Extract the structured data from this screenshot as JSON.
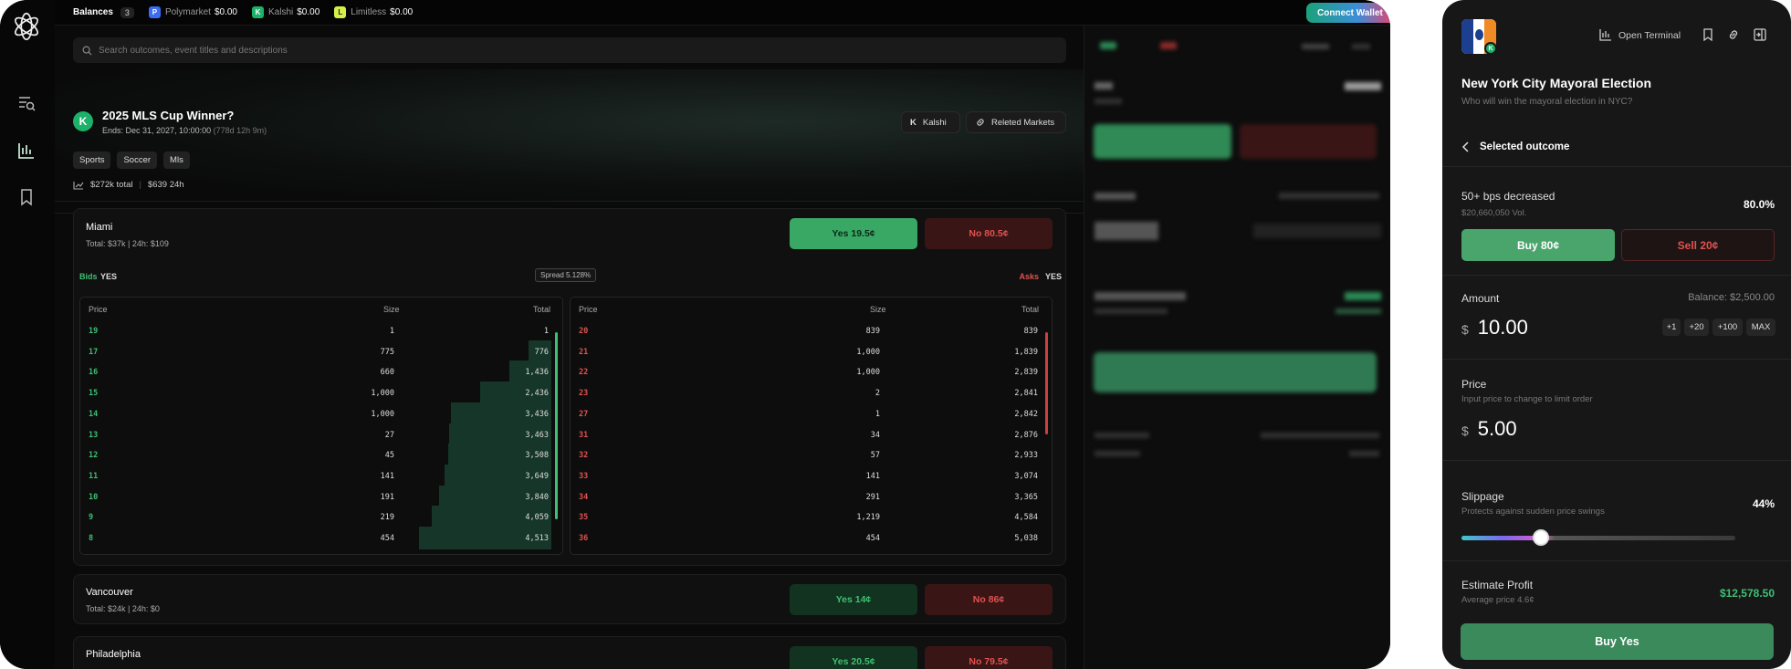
{
  "topbar": {
    "balances_label": "Balances",
    "balances_count": "3",
    "balances": [
      {
        "name": "Polymarket",
        "value": "$0.00",
        "color": "#3b6cf2",
        "icon": "P"
      },
      {
        "name": "Kalshi",
        "value": "$0.00",
        "color": "#1db26a",
        "icon": "K"
      },
      {
        "name": "Limitless",
        "value": "$0.00",
        "color": "#d6f04a",
        "icon": "L"
      }
    ],
    "connect_label": "Connect Wallet"
  },
  "search": {
    "placeholder": "Search outcomes, event titles and descriptions"
  },
  "market": {
    "badge": "K",
    "title": "2025 MLS Cup Winner?",
    "ends": "Ends: Dec 31, 2027, 10:00:00",
    "ends_remaining": "(778d 12h 9m)",
    "source_button": "Kalshi",
    "related_button": "Releted Markets",
    "tags": [
      "Sports",
      "Soccer",
      "Mls"
    ],
    "total": "$272k total",
    "volume_24h": "$639 24h"
  },
  "outcomes": [
    {
      "name": "Miami",
      "stats": "Total: $37k  |  24h: $109",
      "yes": "Yes 19.5¢",
      "no": "No 80.5¢"
    },
    {
      "name": "Vancouver",
      "stats": "Total: $24k  |  24h: $0",
      "yes": "Yes 14¢",
      "no": "No 86¢"
    },
    {
      "name": "Philadelphia",
      "stats": "",
      "yes": "Yes 20.5¢",
      "no": "No 79.5¢"
    }
  ],
  "orderbook": {
    "bids_label": "Bids",
    "asks_label": "Asks",
    "side_label": "YES",
    "spread": "Spread 5.128%",
    "headers": [
      "Price",
      "Size",
      "Total"
    ],
    "bids": [
      {
        "price": "19",
        "size": "1",
        "total": "1",
        "depth": 0.0002
      },
      {
        "price": "17",
        "size": "775",
        "total": "776",
        "depth": 0.17
      },
      {
        "price": "16",
        "size": "660",
        "total": "1,436",
        "depth": 0.32
      },
      {
        "price": "15",
        "size": "1,000",
        "total": "2,436",
        "depth": 0.54
      },
      {
        "price": "14",
        "size": "1,000",
        "total": "3,436",
        "depth": 0.76
      },
      {
        "price": "13",
        "size": "27",
        "total": "3,463",
        "depth": 0.77
      },
      {
        "price": "12",
        "size": "45",
        "total": "3,508",
        "depth": 0.78
      },
      {
        "price": "11",
        "size": "141",
        "total": "3,649",
        "depth": 0.81
      },
      {
        "price": "10",
        "size": "191",
        "total": "3,840",
        "depth": 0.85
      },
      {
        "price": "9",
        "size": "219",
        "total": "4,059",
        "depth": 0.9
      },
      {
        "price": "8",
        "size": "454",
        "total": "4,513",
        "depth": 1.0
      }
    ],
    "asks": [
      {
        "price": "20",
        "size": "839",
        "total": "839"
      },
      {
        "price": "21",
        "size": "1,000",
        "total": "1,839"
      },
      {
        "price": "22",
        "size": "1,000",
        "total": "2,839"
      },
      {
        "price": "23",
        "size": "2",
        "total": "2,841"
      },
      {
        "price": "27",
        "size": "1",
        "total": "2,842"
      },
      {
        "price": "31",
        "size": "34",
        "total": "2,876"
      },
      {
        "price": "32",
        "size": "57",
        "total": "2,933"
      },
      {
        "price": "33",
        "size": "141",
        "total": "3,074"
      },
      {
        "price": "34",
        "size": "291",
        "total": "3,365"
      },
      {
        "price": "35",
        "size": "1,219",
        "total": "4,584"
      },
      {
        "price": "36",
        "size": "454",
        "total": "5,038"
      }
    ]
  },
  "panel": {
    "open_terminal": "Open Terminal",
    "title": "New York City Mayoral Election",
    "subtitle": "Who will win the mayoral election in NYC?",
    "selected_label": "Selected outcome",
    "outcome_name": "50+ bps decreased",
    "outcome_volume": "$20,660,050 Vol.",
    "outcome_pct": "80.0%",
    "buy_label": "Buy 80¢",
    "sell_label": "Sell 20¢",
    "amount_label": "Amount",
    "balance": "Balance: $2,500.00",
    "currency": "$",
    "amount_value": "10.00",
    "chips": [
      "+1",
      "+20",
      "+100",
      "MAX"
    ],
    "price_label": "Price",
    "price_hint": "Input price to change to limit order",
    "price_value": "5.00",
    "slippage_label": "Slippage",
    "slippage_hint": "Protects against sudden price swings",
    "slippage_value": "44%",
    "slippage_level": 0.29,
    "profit_label": "Estimate Profit",
    "profit_hint": "Average price 4.6¢",
    "profit_value": "$12,578.50",
    "buy_yes": "Buy Yes"
  },
  "colors": {
    "green": "#3fbf74",
    "red": "#e0524f",
    "accent": "#3a8a5c"
  }
}
